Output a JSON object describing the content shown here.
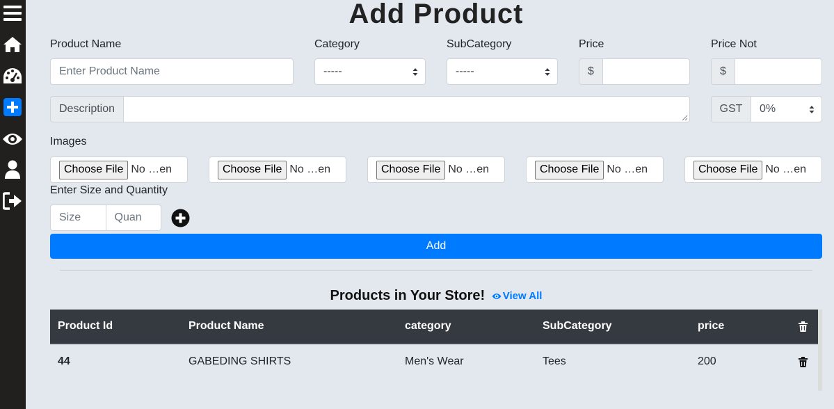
{
  "page": {
    "title": "Add Product"
  },
  "sidebar": {
    "icons": [
      "menu-icon",
      "home-icon",
      "dashboard-icon",
      "add-icon",
      "view-icon",
      "user-icon",
      "logout-icon"
    ],
    "active_color": "#007bff"
  },
  "form": {
    "product_name": {
      "label": "Product Name",
      "placeholder": "Enter Product Name"
    },
    "category": {
      "label": "Category",
      "value": "-----"
    },
    "subcategory": {
      "label": "SubCategory",
      "value": "-----"
    },
    "price": {
      "label": "Price",
      "addon": "$",
      "value": ""
    },
    "price_not": {
      "label": "Price Not",
      "addon": "$",
      "value": ""
    },
    "description": {
      "addon": "Description",
      "value": ""
    },
    "gst": {
      "addon": "GST",
      "value": "0%"
    },
    "images": {
      "label": "Images",
      "files": [
        {
          "button": "Choose File",
          "status": "No …en"
        },
        {
          "button": "Choose File",
          "status": "No …en"
        },
        {
          "button": "Choose File",
          "status": "No …en"
        },
        {
          "button": "Choose File",
          "status": "No …en"
        },
        {
          "button": "Choose File",
          "status": "No …en"
        }
      ]
    },
    "size_quantity": {
      "label": "Enter Size and Quantity",
      "size_placeholder": "Size",
      "quantity_placeholder": "Quan"
    },
    "add_button": "Add"
  },
  "store": {
    "title": "Products in Your Store!",
    "view_all": "View All",
    "columns": [
      "Product Id",
      "Product Name",
      "category",
      "SubCategory",
      "price"
    ],
    "rows": [
      {
        "id": "44",
        "name": "GABEDING SHIRTS",
        "category": "Men's Wear",
        "subcategory": "Tees",
        "price": "200"
      }
    ]
  },
  "colors": {
    "primary": "#007bff",
    "sidebar": "#221f1f",
    "table_header": "#343a40",
    "background": "#e3e8ee"
  }
}
